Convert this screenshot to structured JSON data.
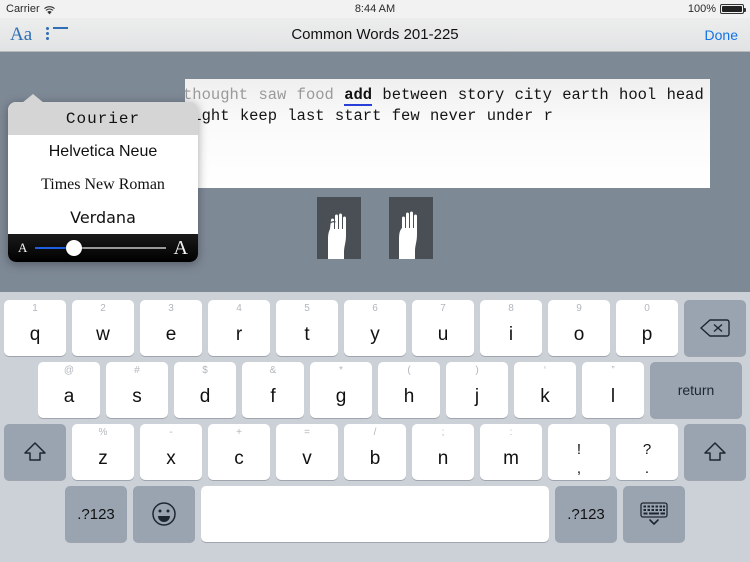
{
  "status_bar": {
    "carrier": "Carrier",
    "wifi_icon": "wifi-icon",
    "time": "8:44 AM",
    "battery_percent": "100%",
    "battery_icon": "battery-full-icon"
  },
  "nav_bar": {
    "font_button_label": "Aa",
    "font_button_icon": "font-aa-icon",
    "list_button_icon": "list-bullets-icon",
    "title": "Common Words 201-225",
    "done_label": "Done"
  },
  "text_panel": {
    "completed_words": [
      "thought",
      "saw",
      "food"
    ],
    "current_word": "add",
    "upcoming_words": [
      "between",
      "story",
      "city",
      "earth",
      "hool",
      "head",
      "light",
      "keep",
      "last",
      "start",
      "few",
      "never",
      "under",
      "r"
    ],
    "full_text": "thought saw food add between story city earth hool head light keep last start few never under r"
  },
  "gesture_cards": [
    {
      "name": "three-finger-hand-icon",
      "fingers": 3
    },
    {
      "name": "four-finger-hand-icon",
      "fingers": 4
    }
  ],
  "font_popover": {
    "fonts": [
      {
        "name": "Courier",
        "selected": true,
        "css_class": "ff-courier"
      },
      {
        "name": "Helvetica Neue",
        "selected": false,
        "css_class": "ff-helv"
      },
      {
        "name": "Times New Roman",
        "selected": false,
        "css_class": "ff-times"
      },
      {
        "name": "Verdana",
        "selected": false,
        "css_class": "ff-verdana"
      }
    ],
    "size_slider": {
      "small_label": "A",
      "large_label": "A",
      "value_percent": 30,
      "fill_color": "#1d5fe0"
    }
  },
  "keyboard": {
    "row1": [
      {
        "main": "q",
        "alt": "1"
      },
      {
        "main": "w",
        "alt": "2"
      },
      {
        "main": "e",
        "alt": "3"
      },
      {
        "main": "r",
        "alt": "4"
      },
      {
        "main": "t",
        "alt": "5"
      },
      {
        "main": "y",
        "alt": "6"
      },
      {
        "main": "u",
        "alt": "7"
      },
      {
        "main": "i",
        "alt": "8"
      },
      {
        "main": "o",
        "alt": "9"
      },
      {
        "main": "p",
        "alt": "0"
      }
    ],
    "backspace_icon": "backspace-delete-icon",
    "row2": [
      {
        "main": "a",
        "alt": "@"
      },
      {
        "main": "s",
        "alt": "#"
      },
      {
        "main": "d",
        "alt": "$"
      },
      {
        "main": "f",
        "alt": "&"
      },
      {
        "main": "g",
        "alt": "*"
      },
      {
        "main": "h",
        "alt": "("
      },
      {
        "main": "j",
        "alt": ")"
      },
      {
        "main": "k",
        "alt": "‘"
      },
      {
        "main": "l",
        "alt": "”"
      }
    ],
    "return_label": "return",
    "row3": [
      {
        "main": "z",
        "alt": "%"
      },
      {
        "main": "x",
        "alt": "-"
      },
      {
        "main": "c",
        "alt": "+"
      },
      {
        "main": "v",
        "alt": "="
      },
      {
        "main": "b",
        "alt": "/"
      },
      {
        "main": "n",
        "alt": ";"
      },
      {
        "main": "m",
        "alt": ":"
      }
    ],
    "punct_keys": [
      {
        "up": "!",
        "dn": ","
      },
      {
        "up": "?",
        "dn": "."
      }
    ],
    "shift_left_icon": "shift-arrow-icon",
    "shift_right_icon": "shift-arrow-icon",
    "numeric_left_label": ".?123",
    "numeric_right_label": ".?123",
    "emoji_icon": "emoji-smiley-icon",
    "space_label": "",
    "hide_keyboard_icon": "hide-keyboard-icon"
  },
  "colors": {
    "accent_blue": "#1273e6",
    "backdrop": "#7e8996",
    "keyboard_bg": "#ccd1d7",
    "key_dark": "#9aa4b0",
    "current_word_underline": "#2a3fd8"
  }
}
